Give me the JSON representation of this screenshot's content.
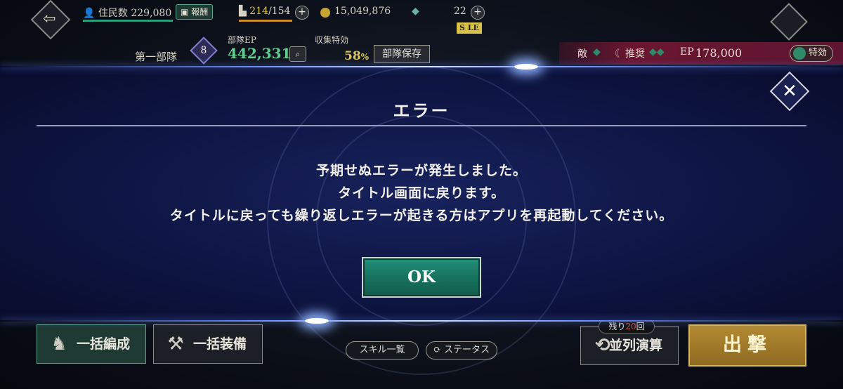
{
  "topbar": {
    "residents_label": "住民数",
    "residents_value": "229,080",
    "reward_button": "報酬",
    "stamina_value": "214",
    "stamina_max": "/154",
    "coins_value": "15,049,876",
    "gems_value": "22",
    "sle_badge": "S LE"
  },
  "party": {
    "name": "第一部隊",
    "rank": "8",
    "ep_label": "部隊EP",
    "ep_value": "442,331",
    "collect_label": "収集特効",
    "collect_value": "58",
    "collect_unit": "%",
    "save_button": "部隊保存"
  },
  "enemy": {
    "enemy_label": "敵",
    "recommend_label": "推奨",
    "ep_label": "EP",
    "ep_value": "178,000",
    "special_button": "特効"
  },
  "modal": {
    "title": "エラー",
    "messages": [
      "予期せぬエラーが発生しました。",
      "タイトル画面に戻ります。",
      "タイトルに戻っても繰り返しエラーが起きる方はアプリを再起動してください。"
    ],
    "ok_button": "OK",
    "close_icon": "✕"
  },
  "bottom": {
    "bulk_form_button": "一括編成",
    "bulk_equip_button": "一括装備",
    "skill_list_button": "スキル一覧",
    "status_button": "ステータス",
    "remaining_prefix": "残り",
    "remaining_count": "20",
    "remaining_suffix": "回",
    "parallel_button": "並列演算",
    "sortie_button": "出撃"
  },
  "colors": {
    "ok_button": "#1e8a74",
    "overlay": "#131c5a",
    "glow": "#8fb2ff",
    "sortie": "#a57e2c",
    "enemy_strip": "#6a1631"
  }
}
